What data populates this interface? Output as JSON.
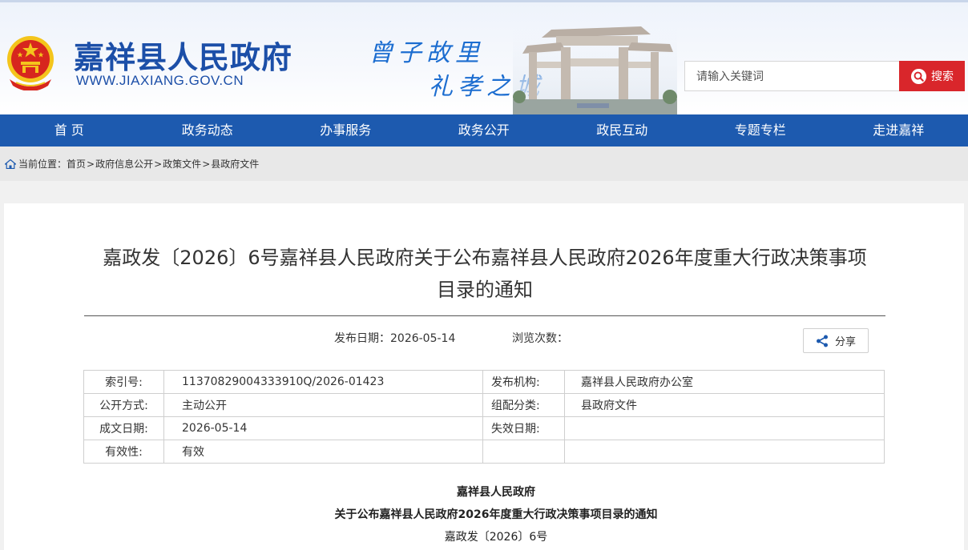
{
  "header": {
    "site_title": "嘉祥县人民政府",
    "site_url": "WWW.JIAXIANG.GOV.CN",
    "slogan_line1": "曾子故里",
    "slogan_line2": "礼孝之城",
    "search_placeholder": "请输入关键词",
    "search_button": "搜索"
  },
  "nav": {
    "items": [
      "首 页",
      "政务动态",
      "办事服务",
      "政务公开",
      "政民互动",
      "专题专栏",
      "走进嘉祥"
    ]
  },
  "breadcrumb": {
    "prefix": "当前位置：",
    "items": [
      "首页",
      "政府信息公开",
      "政策文件",
      "县政府文件"
    ],
    "separator": ">"
  },
  "document": {
    "title_line1": "嘉政发〔2026〕6号嘉祥县人民政府关于公布嘉祥县人民政府2026年度重大行政决策事项",
    "title_line2": "目录的通知",
    "publish_date_label": "发布日期：",
    "publish_date": "2026-05-14",
    "views_label": "浏览次数：",
    "share_label": "分享",
    "info": {
      "index_label": "索引号:",
      "index_value": "11370829004333910Q/2026-01423",
      "publisher_label": "发布机构:",
      "publisher_value": "嘉祥县人民政府办公室",
      "disclosure_label": "公开方式:",
      "disclosure_value": "主动公开",
      "category_label": "组配分类:",
      "category_value": "县政府文件",
      "created_label": "成文日期:",
      "created_value": "2026-05-14",
      "expiry_label": "失效日期:",
      "expiry_value": "",
      "validity_label": "有效性:",
      "validity_value": "有效"
    },
    "body_org": "嘉祥县人民政府",
    "body_heading": "关于公布嘉祥县人民政府2026年度重大行政决策事项目录的通知",
    "body_docno": "嘉政发〔2026〕6号"
  },
  "colors": {
    "brand_blue": "#1d5aaf",
    "search_red": "#d9262b",
    "emblem_red": "#d7261e",
    "emblem_gold": "#f4c51c"
  }
}
